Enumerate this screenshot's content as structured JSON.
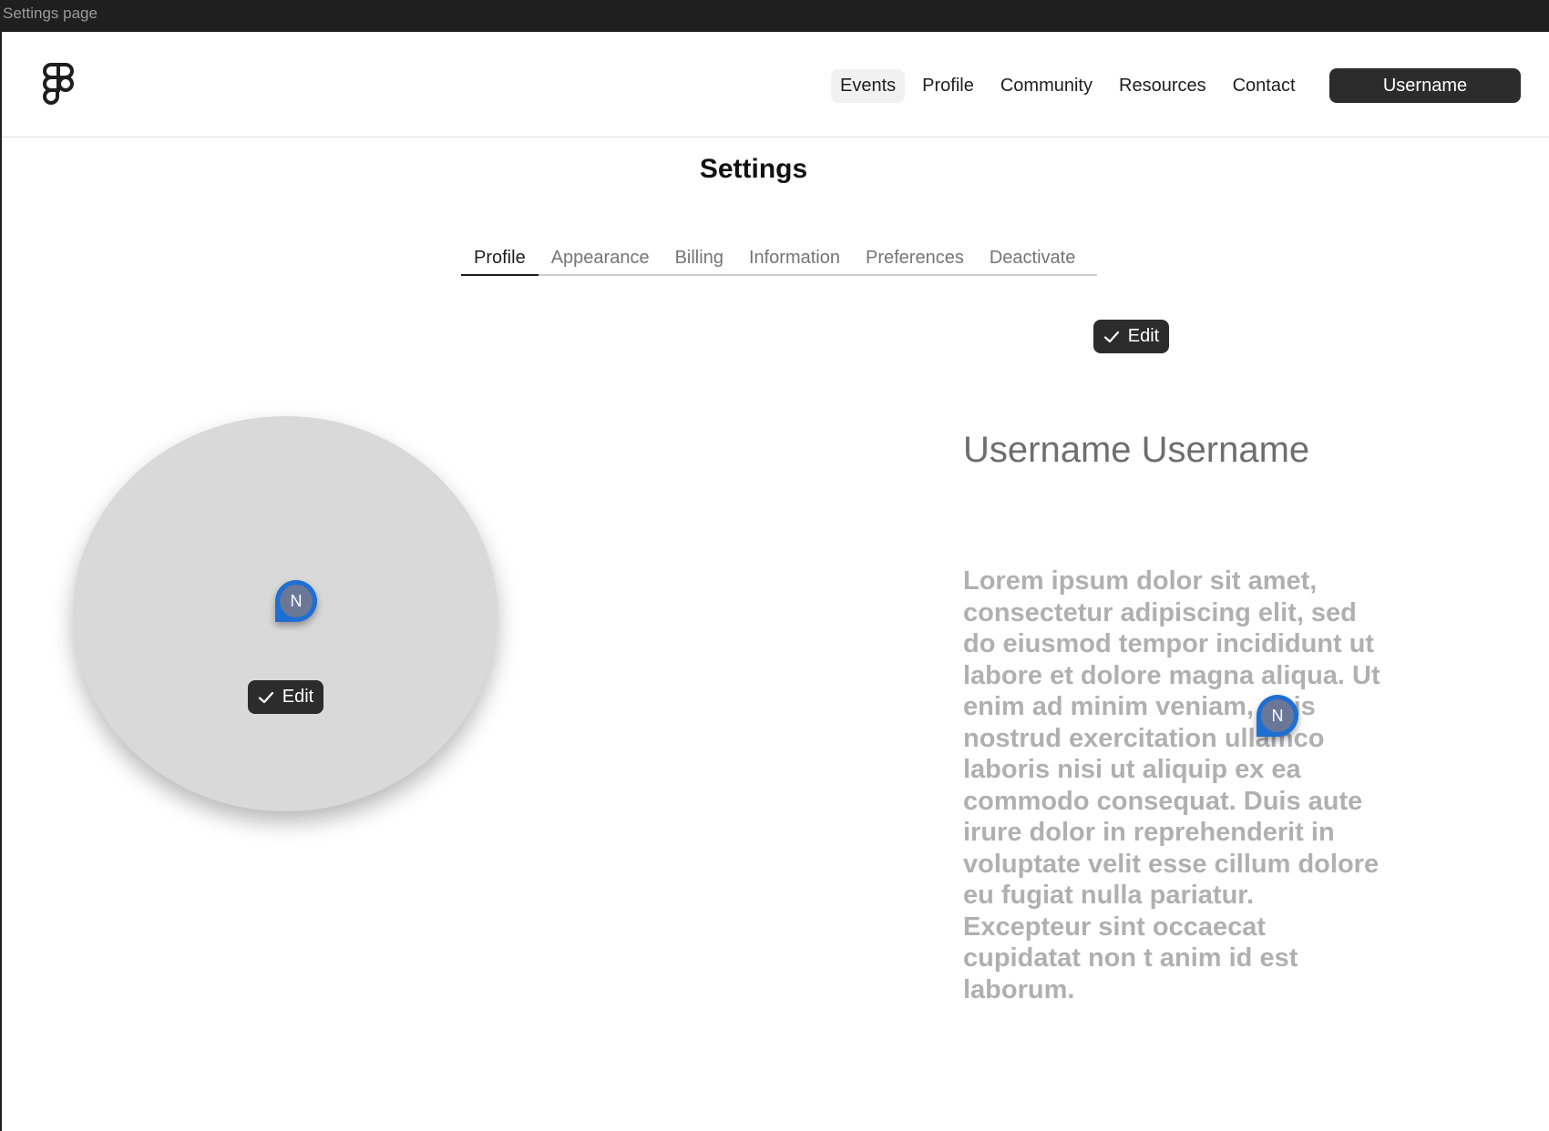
{
  "window": {
    "title": "Settings page"
  },
  "header": {
    "logo_icon": "figma-logo-icon",
    "nav": [
      {
        "label": "Events",
        "active": true
      },
      {
        "label": "Profile",
        "active": false
      },
      {
        "label": "Community",
        "active": false
      },
      {
        "label": "Resources",
        "active": false
      },
      {
        "label": "Contact",
        "active": false
      }
    ],
    "user_button_label": "Username"
  },
  "page": {
    "title": "Settings",
    "tabs": [
      {
        "label": "Profile",
        "active": true
      },
      {
        "label": "Appearance",
        "active": false
      },
      {
        "label": "Billing",
        "active": false
      },
      {
        "label": "Information",
        "active": false
      },
      {
        "label": "Preferences",
        "active": false
      },
      {
        "label": "Deactivate",
        "active": false
      }
    ]
  },
  "profile": {
    "edit_label_top": "Edit",
    "edit_label_avatar": "Edit",
    "name": "Username Username",
    "bio": "Lorem ipsum dolor sit amet, consectetur adipiscing elit, sed do eiusmod tempor incididunt ut labore et dolore magna aliqua. Ut enim ad minim veniam, quis nostrud exercitation ullamco laboris nisi ut aliquip ex ea commodo consequat. Duis aute irure dolor in reprehenderit in voluptate velit esse cillum dolore eu fugiat nulla pariatur. Excepteur sint occaecat cupidatat non t anim id est laborum."
  },
  "comment_markers": [
    {
      "initial": "N"
    },
    {
      "initial": "N"
    }
  ],
  "colors": {
    "dark": "#2c2c2c",
    "marker_blue": "#1e6fd1",
    "avatar_grey": "#d9d9d9"
  }
}
